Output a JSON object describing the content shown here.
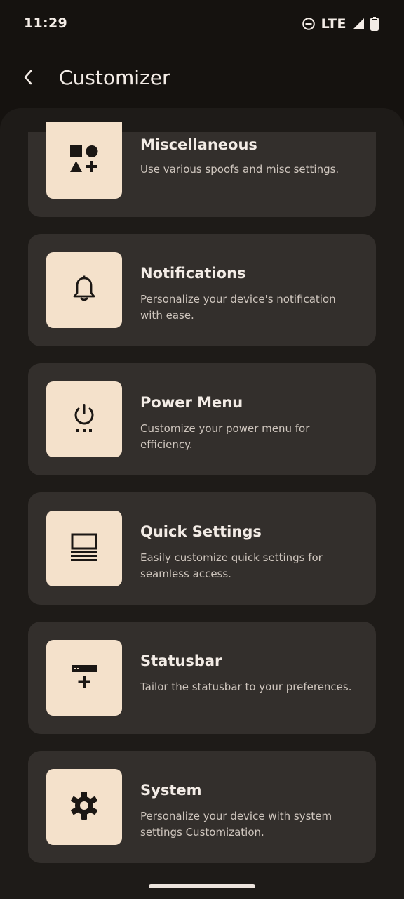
{
  "status_bar": {
    "time": "11:29",
    "network": "LTE",
    "icons": [
      "do-not-disturb-icon",
      "signal-icon",
      "battery-icon"
    ]
  },
  "app_bar": {
    "title": "Customizer",
    "back_icon": "back-arrow-icon"
  },
  "colors": {
    "background": "#15120f",
    "panel": "#1e1b18",
    "card": "#332f2c",
    "icon_tile": "#f4e1cb",
    "icon": "#1b1714",
    "text": "#f3ece6",
    "secondary_text": "#cfc6be"
  },
  "items": [
    {
      "title": "Miscellaneous",
      "description": "Use various spoofs and misc settings.",
      "icon": "shapes-icon"
    },
    {
      "title": "Notifications",
      "description": "Personalize your device's notification with ease.",
      "icon": "bell-icon"
    },
    {
      "title": "Power Menu",
      "description": "Customize your power menu for efficiency.",
      "icon": "power-menu-icon"
    },
    {
      "title": "Quick Settings",
      "description": "Easily customize quick settings for seamless access.",
      "icon": "quick-settings-icon"
    },
    {
      "title": "Statusbar",
      "description": "Tailor the statusbar to your preferences.",
      "icon": "statusbar-add-icon"
    },
    {
      "title": "System",
      "description": "Personalize your device with system settings Customization.",
      "icon": "gear-icon"
    }
  ]
}
